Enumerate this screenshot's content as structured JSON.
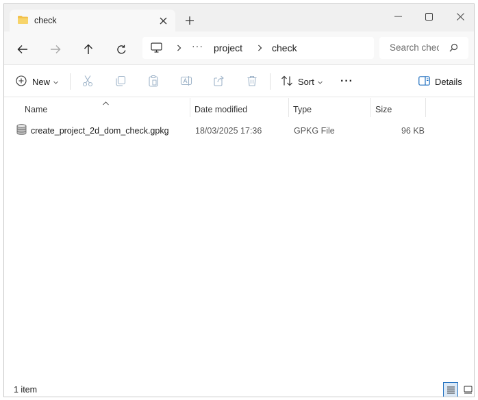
{
  "tab": {
    "title": "check"
  },
  "address": {
    "more": "···",
    "crumbs": [
      "project",
      "check"
    ]
  },
  "search": {
    "placeholder": "Search check"
  },
  "toolbar": {
    "new_label": "New",
    "sort_label": "Sort",
    "more_label": "···",
    "details_label": "Details"
  },
  "columns": {
    "name": "Name",
    "date": "Date modified",
    "type": "Type",
    "size": "Size"
  },
  "files": [
    {
      "name": "create_project_2d_dom_check.gpkg",
      "date": "18/03/2025 17:36",
      "type": "GPKG File",
      "size": "96 KB",
      "icon": "database-icon"
    }
  ],
  "status": {
    "item_count": "1 item"
  },
  "colors": {
    "accent": "#1f6fbf",
    "folder": "#f2c14b"
  }
}
